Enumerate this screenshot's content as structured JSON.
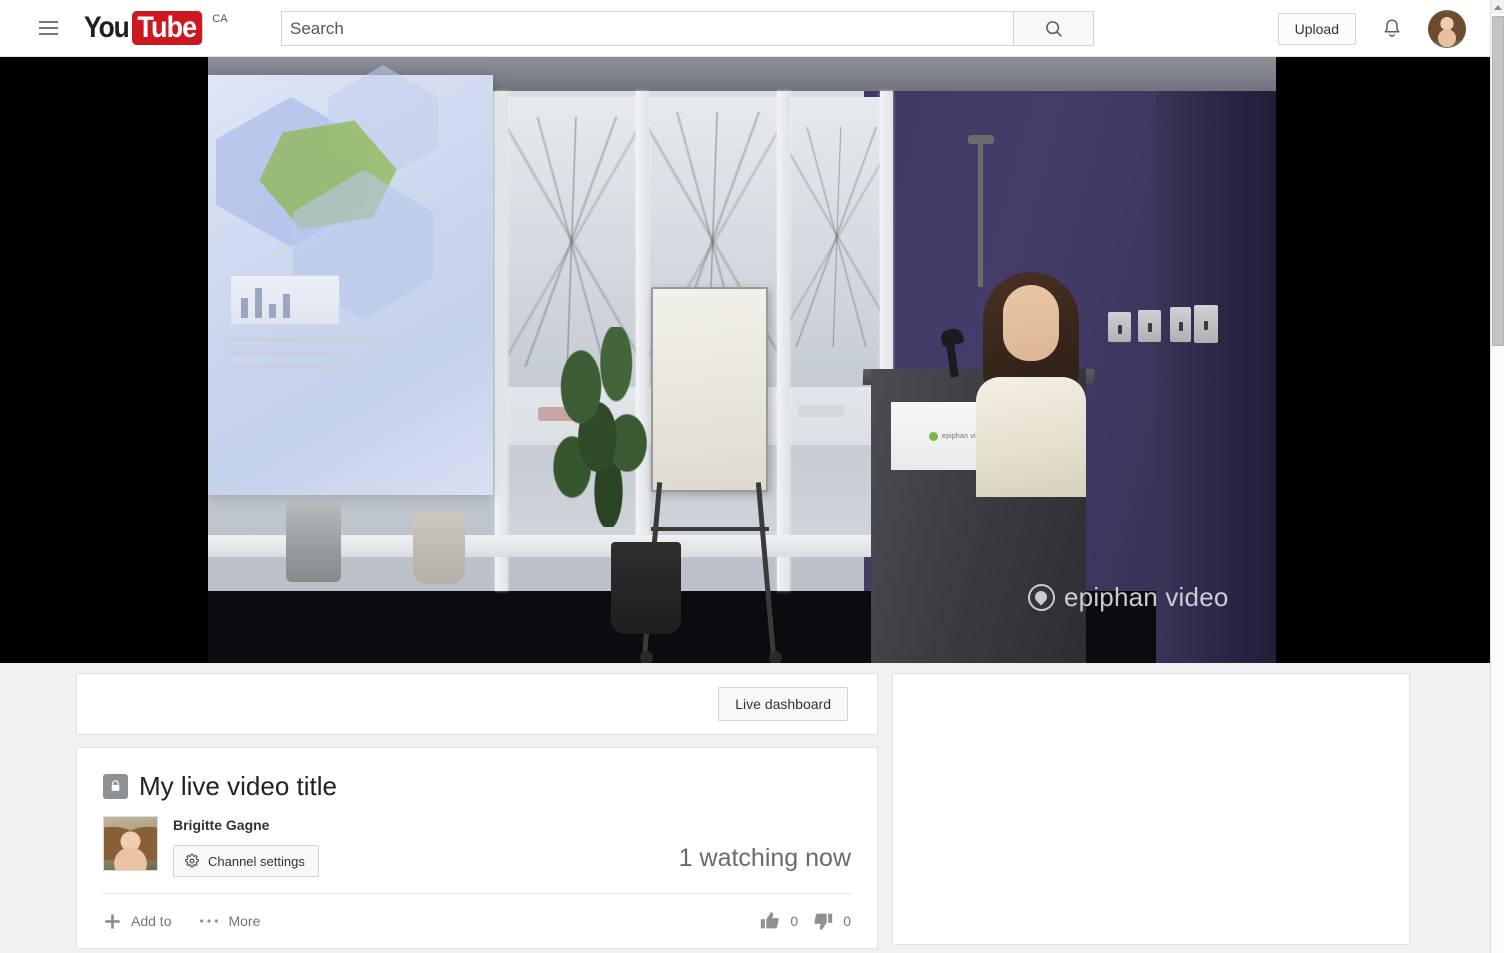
{
  "header": {
    "menu_icon": "hamburger-menu-icon",
    "logo": {
      "you": "You",
      "tube": "Tube",
      "country": "CA"
    },
    "search": {
      "placeholder": "Search",
      "value": "",
      "button_icon": "search-icon"
    },
    "upload_label": "Upload",
    "notifications_icon": "bell-icon",
    "avatar_label": "account-avatar"
  },
  "player": {
    "watermark_text": "epiphan video",
    "podium_sign_text": "epiphan video",
    "state": "live"
  },
  "main": {
    "dashboard_button": "Live dashboard",
    "privacy_icon": "lock-icon",
    "video_title": "My live video title",
    "channel": {
      "name": "Brigitte Gagne",
      "settings_label": "Channel settings",
      "settings_icon": "gear-icon"
    },
    "viewers_text": "1 watching now",
    "actions": [
      {
        "label": "Add to",
        "icon": "plus-icon"
      },
      {
        "label": "More",
        "icon": "ellipsis-icon"
      }
    ],
    "ratings": {
      "like": {
        "icon": "thumbs-up-icon",
        "count": "0"
      },
      "dislike": {
        "icon": "thumbs-down-icon",
        "count": "0"
      }
    }
  },
  "sidebar": {
    "content": ""
  },
  "scrollbar": {
    "up_arrow_icon": "scroll-up-arrow-icon"
  },
  "colors": {
    "brand_red": "#cc181e",
    "page_bg": "#f1f1f1",
    "card_bg": "#ffffff",
    "text_primary": "#222222",
    "text_secondary": "#767676",
    "border": "#e2e2e2"
  }
}
